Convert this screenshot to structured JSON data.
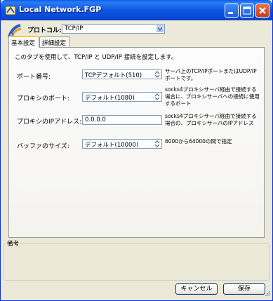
{
  "window": {
    "title": "Local Network.FGP"
  },
  "protocol": {
    "label": "プロトコル:",
    "value": "TCP/IP"
  },
  "tabs": [
    {
      "label": "基本設定",
      "active": true
    },
    {
      "label": "詳細設定",
      "active": false
    }
  ],
  "panel": {
    "description": "このタブを使用して、TCP/IP と UDP/IP 接続を設定します。",
    "rows": [
      {
        "label": "ポート番号:",
        "value": "TCPデフォルト(510)",
        "note": "サーバ上のTCP/IPポートまたはUDP/IPポートです。"
      },
      {
        "label": "プロキシのポート:",
        "value": "デフォルト(1080)",
        "note": "socks4プロキシサーバ経由で接続する場合に、プロキシサーバへの接続に使用するポート"
      },
      {
        "label": "プロキシのIPアドレス:",
        "value": "0.0.0.0",
        "note": "socks4プロキシサーバ経由で接続する場合の、プロキシサーバのIPアドレス"
      },
      {
        "label": "バッファのサイズ:",
        "value": "デフォルト(10000)",
        "note": "6000から64000の間で指定"
      }
    ]
  },
  "remarks": {
    "label": "備考"
  },
  "buttons": {
    "cancel": "キャンセル",
    "save": "保存"
  },
  "colors": {
    "titlebar": "#0b55e0",
    "close_button": "#c4401b",
    "tab_highlight": "#ffc83c",
    "background": "#ece9d8"
  }
}
